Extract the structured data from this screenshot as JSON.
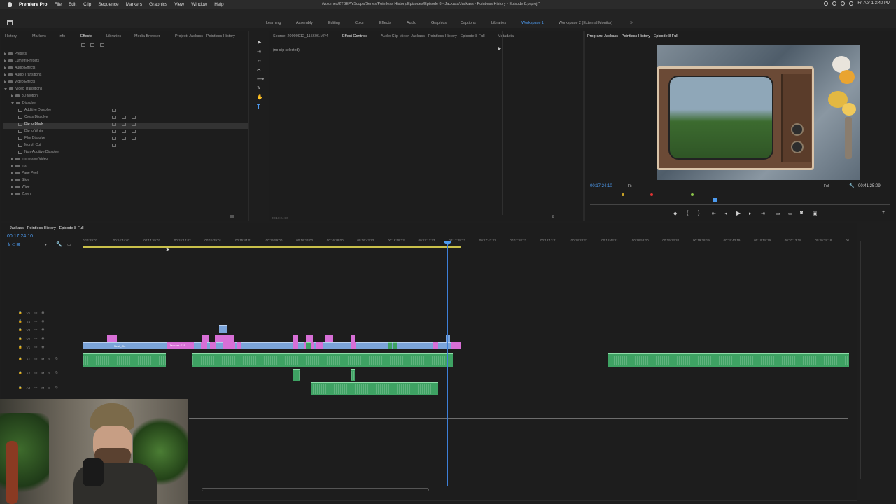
{
  "menubar": {
    "app_name": "Premiere Pro",
    "menus": [
      "File",
      "Edit",
      "Clip",
      "Sequence",
      "Markers",
      "Graphics",
      "View",
      "Window",
      "Help"
    ],
    "doc_path": "/Volumes/2TBEPYScopa/Series/Pointless History/Episodes/Episode 8 - Jackass/Jackass - Pointless History - Episode 8.prproj *",
    "datetime": "Fri Apr 1  3:40 PM"
  },
  "workspaces": {
    "items": [
      "Learning",
      "Assembly",
      "Editing",
      "Color",
      "Effects",
      "Audio",
      "Graphics",
      "Captions",
      "Libraries",
      "Workspace 1",
      "Workspace 2 (External Monitor)"
    ],
    "active": "Workspace 1"
  },
  "left_panel": {
    "tabs": [
      "History",
      "Markers",
      "Info",
      "Effects",
      "Libraries",
      "Media Browser",
      "Project: Jackass - Pointless History"
    ],
    "active_tab": "Effects",
    "tree": [
      {
        "label": "Presets",
        "level": 0,
        "open": false
      },
      {
        "label": "Lumetri Presets",
        "level": 0,
        "open": false
      },
      {
        "label": "Audio Effects",
        "level": 0,
        "open": false
      },
      {
        "label": "Audio Transitions",
        "level": 0,
        "open": false
      },
      {
        "label": "Video Effects",
        "level": 0,
        "open": false
      },
      {
        "label": "Video Transitions",
        "level": 0,
        "open": true
      },
      {
        "label": "3D Motion",
        "level": 1,
        "open": false
      },
      {
        "label": "Dissolve",
        "level": 1,
        "open": true
      },
      {
        "label": "Additive Dissolve",
        "level": 2,
        "item": true
      },
      {
        "label": "Cross Dissolve",
        "level": 2,
        "item": true
      },
      {
        "label": "Dip to Black",
        "level": 2,
        "item": true,
        "selected": true
      },
      {
        "label": "Dip to White",
        "level": 2,
        "item": true
      },
      {
        "label": "Film Dissolve",
        "level": 2,
        "item": true
      },
      {
        "label": "Morph Cut",
        "level": 2,
        "item": true
      },
      {
        "label": "Non-Additive Dissolve",
        "level": 2,
        "item": true
      },
      {
        "label": "Immersive Video",
        "level": 1,
        "open": false
      },
      {
        "label": "Iris",
        "level": 1,
        "open": false
      },
      {
        "label": "Page Peel",
        "level": 1,
        "open": false
      },
      {
        "label": "Slide",
        "level": 1,
        "open": false
      },
      {
        "label": "Wipe",
        "level": 1,
        "open": false
      },
      {
        "label": "Zoom",
        "level": 1,
        "open": false
      }
    ]
  },
  "source_panel": {
    "tabs": [
      "Source: 20000912_115606.MP4",
      "Effect Controls",
      "Audio Clip Mixer: Jackass - Pointless History - Episode 8 Full",
      "Metadata"
    ],
    "active_tab": "Effect Controls",
    "no_clip": "(no clip selected)",
    "timecode": "00:17:24:10"
  },
  "program_panel": {
    "title": "Program: Jackass - Pointless History - Episode 8 Full",
    "timecode": "00:17:24:10",
    "fit": "Fit",
    "quality": "Full",
    "duration": "00:41:25:09"
  },
  "timeline": {
    "sequence_tab": "Jackass - Pointless History - Episode 8 Full",
    "timecode": "00:17:24:10",
    "ruler": [
      "0:14:29:03",
      "00:14:44:02",
      "00:14:59:02",
      "00:15:14:02",
      "00:15:29:01",
      "00:15:44:01",
      "00:15:59:00",
      "00:16:14:00",
      "00:16:28:00",
      "00:16:43:23",
      "00:16:58:23",
      "00:17:13:23",
      "00:17:28:22",
      "00:17:43:22",
      "00:17:58:22",
      "00:18:13:21",
      "00:18:28:21",
      "00:18:43:21",
      "00:18:58:20",
      "00:19:13:20",
      "00:19:28:19",
      "00:19:43:19",
      "00:19:58:19",
      "00:20:13:18",
      "00:20:28:18",
      "00"
    ],
    "video_tracks": [
      "V5",
      "V4",
      "V3",
      "V2",
      "V1"
    ],
    "audio_tracks": [
      "A1",
      "A2",
      "A3"
    ],
    "clip_labels": {
      "v1_a": "Nest_Cle",
      "v1_b": "Jackass S1E"
    },
    "track_buttons": {
      "mute": "M",
      "solo": "S"
    }
  },
  "colors": {
    "accent": "#4d9bf0",
    "video_clip": "#7ba4d9",
    "pink_clip": "#d76fd6",
    "audio_clip": "#3ea263"
  },
  "icons": [
    "apple-icon",
    "home-icon",
    "selection-tool-icon",
    "ripple-edit-icon",
    "razor-icon",
    "slip-icon",
    "pen-icon",
    "hand-icon",
    "type-icon",
    "play-icon",
    "step-back-icon",
    "step-forward-icon",
    "marker-icon",
    "export-frame-icon",
    "wrench-icon",
    "lock-icon",
    "eye-icon",
    "mic-icon"
  ]
}
